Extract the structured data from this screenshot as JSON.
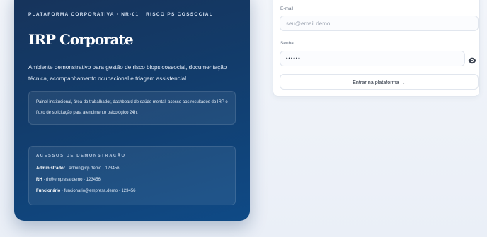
{
  "hero": {
    "kicker": "PLATAFORMA CORPORATIVA · NR-01 · RISCO PSICOSSOCIAL",
    "title": "IRP Corporate",
    "description": "Ambiente demonstrativo para gestão de risco biopsicossocial, documentação técnica, acompanhamento ocupacional e triagem assistencial.",
    "info": "Painel institucional, área do trabalhador, dashboard de saúde mental, acesso aos resultados do IRP e fluxo de solicitação para atendimento psicológico 24h."
  },
  "demo": {
    "heading": "ACESSOS DE DEMONSTRAÇÃO",
    "accounts": [
      {
        "role": "Administrador",
        "details": " · admin@irp.demo · 123456"
      },
      {
        "role": "RH",
        "details": " · rh@empresa.demo · 123456"
      },
      {
        "role": "Funcionário",
        "details": " · funcionario@empresa.demo · 123456"
      }
    ]
  },
  "login": {
    "email_label": "E-mail",
    "email_placeholder": "seu@email.demo",
    "password_label": "Senha",
    "password_value": "••••••",
    "submit_label": "Entrar na plataforma →"
  },
  "colors": {
    "hero_start": "#17335a",
    "hero_end": "#0f4a86",
    "background": "#eef2f8"
  },
  "icons": {
    "password_toggle": "eye-icon"
  }
}
